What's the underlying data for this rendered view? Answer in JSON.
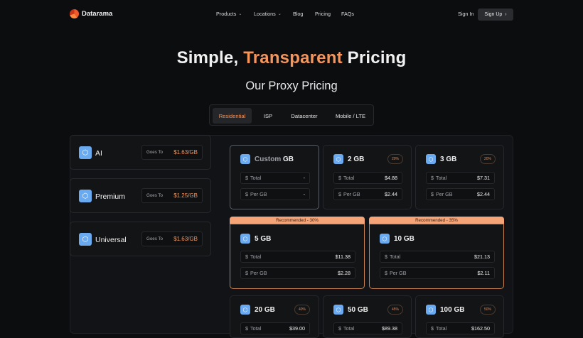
{
  "nav": {
    "brand": "Datarama",
    "items": [
      "Products",
      "Locations",
      "Blog",
      "Pricing",
      "FAQs"
    ],
    "sign_in": "Sign In",
    "sign_up": "Sign Up"
  },
  "hero": {
    "title_part1": "Simple,",
    "title_accent": "Transparent",
    "title_part2": "Pricing",
    "subtitle": "Our Proxy Pricing"
  },
  "tabs": [
    "Residential",
    "ISP",
    "Datacenter",
    "Mobile / LTE"
  ],
  "active_tab": "Residential",
  "colors": {
    "accent": "#f4955c",
    "icon": "#6aaaf0",
    "background": "#0c0d0f"
  },
  "plans": [
    {
      "name": "AI",
      "goes_to_label": "Goes To",
      "price": "$1.63/GB"
    },
    {
      "name": "Premium",
      "goes_to_label": "Goes To",
      "price": "$1.25/GB"
    },
    {
      "name": "Universal",
      "goes_to_label": "Goes To",
      "price": "$1.63/GB"
    }
  ],
  "custom": {
    "prefix": "Custom",
    "unit": "GB",
    "total_label": "Total",
    "total_value": "-",
    "per_label": "Per GB",
    "per_value": "-"
  },
  "packages": [
    {
      "size": "2 GB",
      "badge": "20%",
      "total_label": "Total",
      "total": "$4.88",
      "per_label": "Per GB",
      "per": "$2.44"
    },
    {
      "size": "3 GB",
      "badge": "20%",
      "total_label": "Total",
      "total": "$7.31",
      "per_label": "Per GB",
      "per": "$2.44"
    },
    {
      "size": "5 GB",
      "recommended": "Recommended - 30%",
      "total_label": "Total",
      "total": "$11.38",
      "per_label": "Per GB",
      "per": "$2.28"
    },
    {
      "size": "10 GB",
      "recommended": "Recommended - 35%",
      "total_label": "Total",
      "total": "$21.13",
      "per_label": "Per GB",
      "per": "$2.11"
    },
    {
      "size": "20 GB",
      "badge": "40%",
      "total_label": "Total",
      "total": "$39.00"
    },
    {
      "size": "50 GB",
      "badge": "45%",
      "total_label": "Total",
      "total": "$89.38"
    },
    {
      "size": "100 GB",
      "badge": "50%",
      "total_label": "Total",
      "total": "$162.50"
    }
  ]
}
